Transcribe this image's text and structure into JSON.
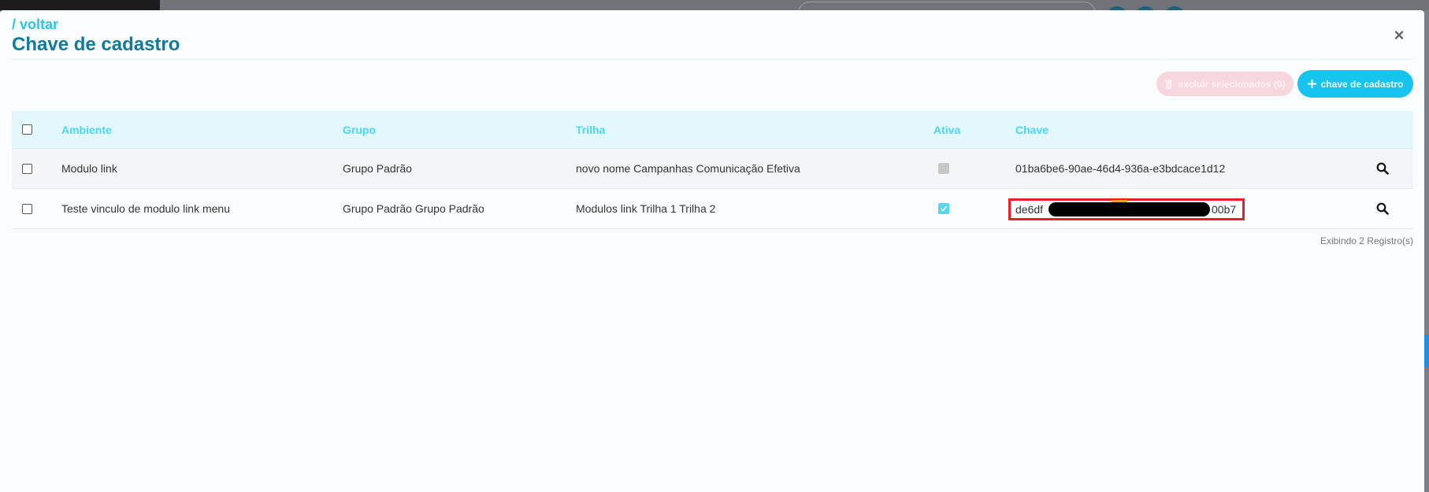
{
  "modal": {
    "back_label": "/ voltar",
    "title": "Chave de cadastro",
    "close_glyph": "×"
  },
  "toolbar": {
    "delete_selected_label": "excluir selecionados (0)",
    "add_key_label": "chave de cadastro",
    "add_icon": "plus-icon",
    "delete_icon": "trash-icon"
  },
  "table": {
    "columns": [
      "Ambiente",
      "Grupo",
      "Trilha",
      "Ativa",
      "Chave"
    ],
    "rows": [
      {
        "ambiente": "Modulo link",
        "grupo": "Grupo Padrão",
        "trilha": "novo nome Campanhas Comunicação Efetiva",
        "ativa": false,
        "chave": "01ba6be6-90ae-46d4-936a-e3bdcace1d12"
      },
      {
        "ambiente": "Teste vinculo de modulo link menu",
        "grupo": "Grupo Padrão Grupo Padrão",
        "trilha": "Modulos link Trilha 1 Trilha 2",
        "ativa": true,
        "chave_start": "de6df",
        "chave_end": "00b7"
      }
    ]
  },
  "footer": {
    "count_text": "Exibindo 2 Registro(s)"
  },
  "colors": {
    "accent": "#17c3ef",
    "title": "#107a98",
    "highlight_box": "#ee1c24"
  }
}
